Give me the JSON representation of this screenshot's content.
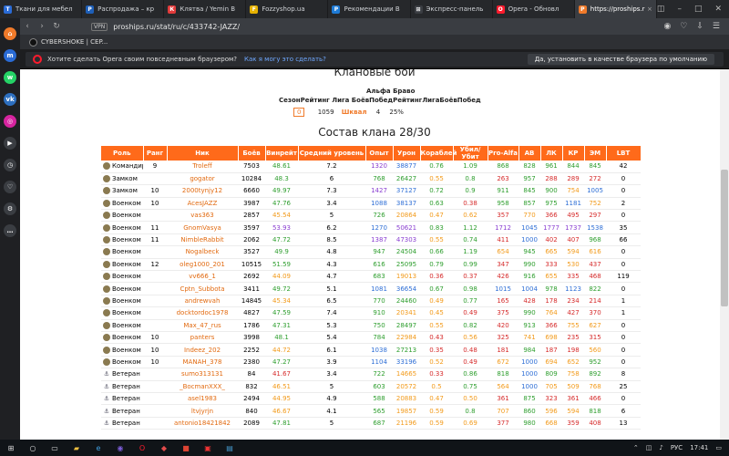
{
  "tabs": [
    {
      "label": "Ткани для мебел",
      "color": "#2a6bd6",
      "glyph": "Т"
    },
    {
      "label": "Распродажа – кр",
      "color": "#1e5fb8",
      "glyph": "Р"
    },
    {
      "label": "Клятва / Yemin В",
      "color": "#e23b3b",
      "glyph": "К"
    },
    {
      "label": "Fozzyshop.ua",
      "color": "#e6b200",
      "glyph": "F"
    },
    {
      "label": "Рекомендации В",
      "color": "#1e7bd6",
      "glyph": "Р"
    },
    {
      "label": "Экспресс-панель",
      "color": "#3a3d42",
      "glyph": "⊞"
    },
    {
      "label": "Opera - Обновл",
      "color": "#ff1b2d",
      "glyph": "O"
    },
    {
      "label": "https://proships.r",
      "color": "#f07a2a",
      "glyph": "P"
    }
  ],
  "address": {
    "vpn": "VPN",
    "url": "proships.ru/stat/ru/c/433742-JAZZ/"
  },
  "bookmark": {
    "label": "CYBERSHOKE | CEP..."
  },
  "notification": {
    "text": "Хотите сделать Opera своим повседневным браузером?",
    "link": "Как я могу это сделать?",
    "button": "Да, установить в качестве браузера по умолчанию"
  },
  "clan": {
    "title": "Клановые бои",
    "header_top": "Альфа Браво",
    "header_row": "СезонРейтинг Лига БоёвПобедРейтингЛигаБоёвПобед",
    "season": "0",
    "rating": "1059",
    "league": "Шквал",
    "battles": "4",
    "wins": "25%"
  },
  "composition_title": "Состав клана 28/30",
  "columns": [
    "Роль",
    "Ранг",
    "Ник",
    "Боёв",
    "Винрейт",
    "Средний уровень",
    "Опыт",
    "Урон",
    "Кораблей",
    "Убил/Убит",
    "Pro-Alfa",
    "АВ",
    "ЛК",
    "КР",
    "ЭМ",
    "LBT"
  ],
  "rows": [
    {
      "role": "Командир",
      "icon": "medal",
      "rank": "9",
      "nick": "Troleff",
      "battles": "7503",
      "wr": "48.61",
      "lvl": "7.2",
      "xp": "1320",
      "dmg": "38877",
      "ships": "0.76",
      "kd": "1.09",
      "pa": "868",
      "av": "828",
      "lk": "961",
      "kr": "844",
      "em": "845",
      "lbt": "42"
    },
    {
      "role": "Замком",
      "icon": "medal",
      "rank": "",
      "nick": "gogator",
      "battles": "10284",
      "wr": "48.3",
      "lvl": "6",
      "xp": "768",
      "dmg": "26427",
      "ships": "0.55",
      "kd": "0.8",
      "pa": "263",
      "av": "957",
      "lk": "288",
      "kr": "289",
      "em": "272",
      "lbt": "0"
    },
    {
      "role": "Замком",
      "icon": "medal",
      "rank": "10",
      "nick": "2000tynjy12",
      "battles": "6660",
      "wr": "49.97",
      "lvl": "7.3",
      "xp": "1427",
      "dmg": "37127",
      "ships": "0.72",
      "kd": "0.9",
      "pa": "911",
      "av": "845",
      "lk": "900",
      "kr": "754",
      "em": "1005",
      "lbt": "0"
    },
    {
      "role": "Военком",
      "icon": "medal",
      "rank": "10",
      "nick": "AcesJAZZ",
      "battles": "3987",
      "wr": "47.76",
      "lvl": "3.4",
      "xp": "1088",
      "dmg": "38137",
      "ships": "0.63",
      "kd": "0.38",
      "pa": "958",
      "av": "857",
      "lk": "975",
      "kr": "1181",
      "em": "752",
      "lbt": "2"
    },
    {
      "role": "Военком",
      "icon": "medal",
      "rank": "",
      "nick": "vas363",
      "battles": "2857",
      "wr": "45.54",
      "lvl": "5",
      "xp": "726",
      "dmg": "20864",
      "ships": "0.47",
      "kd": "0.62",
      "pa": "357",
      "av": "770",
      "lk": "366",
      "kr": "495",
      "em": "297",
      "lbt": "0"
    },
    {
      "role": "Военком",
      "icon": "medal",
      "rank": "11",
      "nick": "GnomVasya",
      "battles": "3597",
      "wr": "53.93",
      "lvl": "6.2",
      "xp": "1270",
      "dmg": "50621",
      "ships": "0.83",
      "kd": "1.12",
      "pa": "1712",
      "av": "1045",
      "lk": "1777",
      "kr": "1737",
      "em": "1538",
      "lbt": "35"
    },
    {
      "role": "Военком",
      "icon": "medal",
      "rank": "11",
      "nick": "NimbleRabbit",
      "battles": "2062",
      "wr": "47.72",
      "lvl": "8.5",
      "xp": "1387",
      "dmg": "47303",
      "ships": "0.55",
      "kd": "0.74",
      "pa": "411",
      "av": "1000",
      "lk": "402",
      "kr": "407",
      "em": "968",
      "lbt": "66"
    },
    {
      "role": "Военком",
      "icon": "medal",
      "rank": "",
      "nick": "Nogalbeck",
      "battles": "3527",
      "wr": "49.9",
      "lvl": "4.8",
      "xp": "947",
      "dmg": "24504",
      "ships": "0.66",
      "kd": "1.19",
      "pa": "654",
      "av": "945",
      "lk": "665",
      "kr": "594",
      "em": "616",
      "lbt": "0"
    },
    {
      "role": "Военком",
      "icon": "medal",
      "rank": "12",
      "nick": "oleg1000_201",
      "battles": "10515",
      "wr": "51.59",
      "lvl": "4.3",
      "xp": "616",
      "dmg": "25095",
      "ships": "0.79",
      "kd": "0.99",
      "pa": "347",
      "av": "990",
      "lk": "333",
      "kr": "530",
      "em": "437",
      "lbt": "0"
    },
    {
      "role": "Военком",
      "icon": "medal",
      "rank": "",
      "nick": "vv666_1",
      "battles": "2692",
      "wr": "44.09",
      "lvl": "4.7",
      "xp": "683",
      "dmg": "19013",
      "ships": "0.36",
      "kd": "0.37",
      "pa": "426",
      "av": "916",
      "lk": "655",
      "kr": "335",
      "em": "468",
      "lbt": "119"
    },
    {
      "role": "Военком",
      "icon": "medal",
      "rank": "",
      "nick": "Cptn_Subbota",
      "battles": "3411",
      "wr": "49.72",
      "lvl": "5.1",
      "xp": "1081",
      "dmg": "36654",
      "ships": "0.67",
      "kd": "0.98",
      "pa": "1015",
      "av": "1004",
      "lk": "978",
      "kr": "1123",
      "em": "822",
      "lbt": "0"
    },
    {
      "role": "Военком",
      "icon": "medal",
      "rank": "",
      "nick": "andrewvah",
      "battles": "14845",
      "wr": "45.34",
      "lvl": "6.5",
      "xp": "770",
      "dmg": "24460",
      "ships": "0.49",
      "kd": "0.77",
      "pa": "165",
      "av": "428",
      "lk": "178",
      "kr": "234",
      "em": "214",
      "lbt": "1"
    },
    {
      "role": "Военком",
      "icon": "medal",
      "rank": "",
      "nick": "docktordoc1978",
      "battles": "4827",
      "wr": "47.59",
      "lvl": "7.4",
      "xp": "910",
      "dmg": "20341",
      "ships": "0.45",
      "kd": "0.49",
      "pa": "375",
      "av": "990",
      "lk": "764",
      "kr": "427",
      "em": "370",
      "lbt": "1"
    },
    {
      "role": "Военком",
      "icon": "medal",
      "rank": "",
      "nick": "Max_47_rus",
      "battles": "1786",
      "wr": "47.31",
      "lvl": "5.3",
      "xp": "750",
      "dmg": "28497",
      "ships": "0.55",
      "kd": "0.82",
      "pa": "420",
      "av": "913",
      "lk": "366",
      "kr": "755",
      "em": "627",
      "lbt": "0"
    },
    {
      "role": "Военком",
      "icon": "medal",
      "rank": "10",
      "nick": "panters",
      "battles": "3998",
      "wr": "48.1",
      "lvl": "5.4",
      "xp": "784",
      "dmg": "22984",
      "ships": "0.43",
      "kd": "0.56",
      "pa": "325",
      "av": "741",
      "lk": "698",
      "kr": "235",
      "em": "315",
      "lbt": "0"
    },
    {
      "role": "Военком",
      "icon": "medal",
      "rank": "10",
      "nick": "Indeez_202",
      "battles": "2252",
      "wr": "44.72",
      "lvl": "6.1",
      "xp": "1038",
      "dmg": "27213",
      "ships": "0.35",
      "kd": "0.48",
      "pa": "181",
      "av": "984",
      "lk": "187",
      "kr": "198",
      "em": "560",
      "lbt": "0"
    },
    {
      "role": "Военком",
      "icon": "medal",
      "rank": "10",
      "nick": "MANAH_378",
      "battles": "2380",
      "wr": "47.27",
      "lvl": "3.9",
      "xp": "1104",
      "dmg": "33196",
      "ships": "0.52",
      "kd": "0.49",
      "pa": "672",
      "av": "1000",
      "lk": "694",
      "kr": "652",
      "em": "952",
      "lbt": "0"
    },
    {
      "role": "Ветеран",
      "icon": "anchor",
      "rank": "",
      "nick": "sumo313131",
      "battles": "84",
      "wr": "41.67",
      "lvl": "3.4",
      "xp": "722",
      "dmg": "14665",
      "ships": "0.33",
      "kd": "0.86",
      "pa": "818",
      "av": "1000",
      "lk": "809",
      "kr": "758",
      "em": "892",
      "lbt": "8"
    },
    {
      "role": "Ветеран",
      "icon": "anchor",
      "rank": "",
      "nick": "_BocmanXXX_",
      "battles": "832",
      "wr": "46.51",
      "lvl": "5",
      "xp": "603",
      "dmg": "20572",
      "ships": "0.5",
      "kd": "0.75",
      "pa": "564",
      "av": "1000",
      "lk": "705",
      "kr": "509",
      "em": "768",
      "lbt": "25"
    },
    {
      "role": "Ветеран",
      "icon": "anchor",
      "rank": "",
      "nick": "asel1983",
      "battles": "2494",
      "wr": "44.95",
      "lvl": "4.9",
      "xp": "588",
      "dmg": "20883",
      "ships": "0.47",
      "kd": "0.50",
      "pa": "361",
      "av": "875",
      "lk": "323",
      "kr": "361",
      "em": "466",
      "lbt": "0"
    },
    {
      "role": "Ветеран",
      "icon": "anchor",
      "rank": "",
      "nick": "ltvjyrjn",
      "battles": "840",
      "wr": "46.67",
      "lvl": "4.1",
      "xp": "565",
      "dmg": "19857",
      "ships": "0.59",
      "kd": "0.8",
      "pa": "707",
      "av": "860",
      "lk": "596",
      "kr": "594",
      "em": "818",
      "lbt": "6"
    },
    {
      "role": "Ветеран",
      "icon": "anchor",
      "rank": "",
      "nick": "antonio18421842",
      "battles": "2089",
      "wr": "47.81",
      "lvl": "5",
      "xp": "687",
      "dmg": "21196",
      "ships": "0.59",
      "kd": "0.69",
      "pa": "377",
      "av": "980",
      "lk": "668",
      "kr": "359",
      "em": "408",
      "lbt": "13"
    }
  ],
  "taskbar": {
    "lang": "РУС",
    "time": "17:41"
  },
  "colors": {
    "accent": "#ff6a1a",
    "nick": "#e26a10",
    "green": "#2e9e2e",
    "blue": "#2f6fd6",
    "purple": "#8a3fd1",
    "red": "#d62b2b",
    "orange": "#f29a1a"
  }
}
